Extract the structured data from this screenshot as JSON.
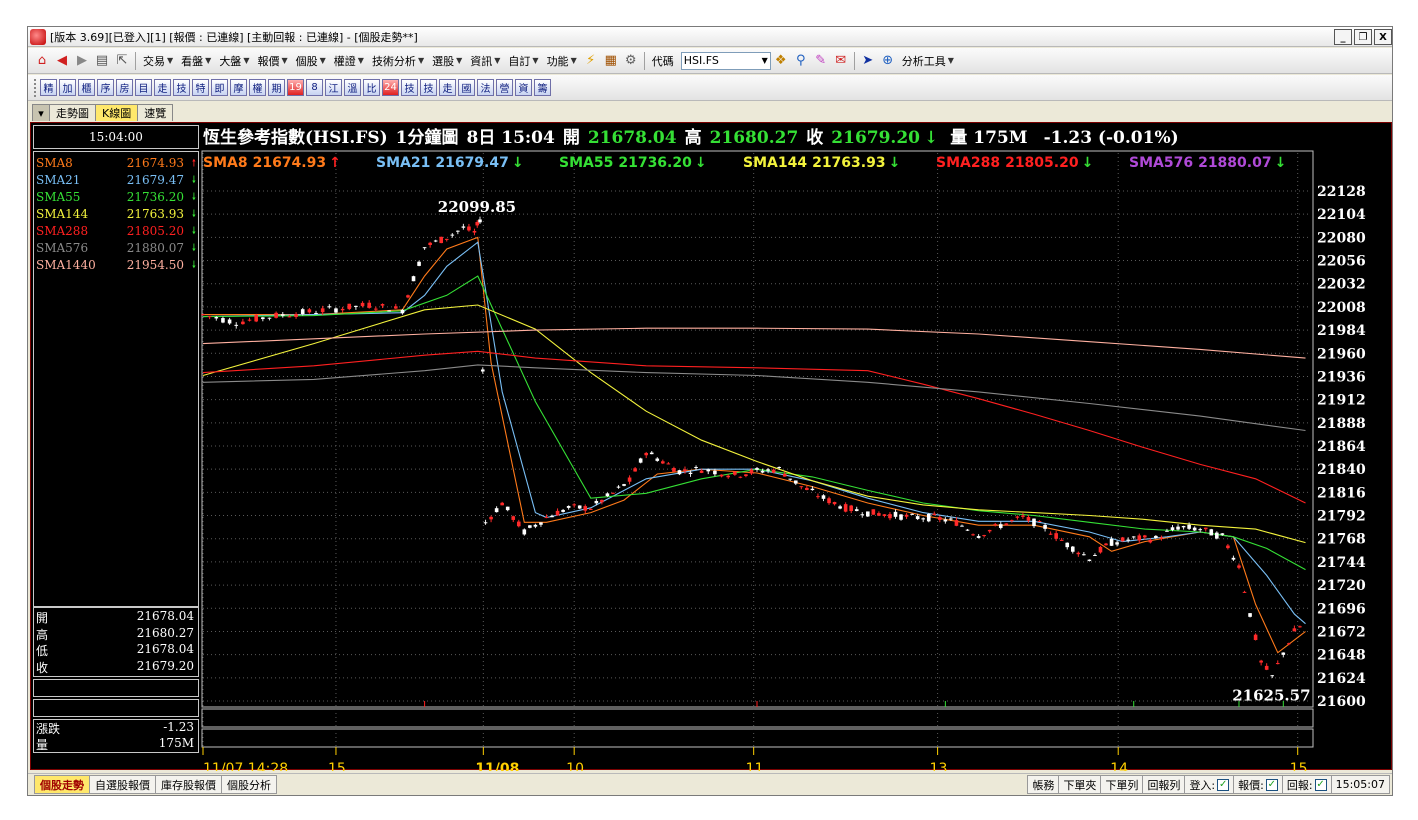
{
  "window": {
    "title": "[版本 3.69][已登入][1] [報價 : 已連線] [主動回報 : 已連線] - [個股走勢**]",
    "buttons": [
      "_",
      "❐",
      "X"
    ]
  },
  "menu": {
    "items": [
      "交易",
      "看盤",
      "大盤",
      "報價",
      "個股",
      "權證",
      "技術分析",
      "選股",
      "資訊",
      "自訂",
      "功能"
    ],
    "code_label": "代碼",
    "code_value": "HSI.FS",
    "analysis_label": "分析工具"
  },
  "toolbar2": {
    "buttons": [
      "精",
      "加",
      "櫃",
      "序",
      "房",
      "目",
      "走",
      "技",
      "特",
      "即",
      "摩",
      "權",
      "期",
      "19",
      "8",
      "江",
      "溫",
      "比",
      "24",
      "技",
      "技",
      "走",
      "國",
      "法",
      "營",
      "資",
      "籌"
    ]
  },
  "tabs": [
    "走勢圖",
    "K線圖",
    "速覽"
  ],
  "left_panel": {
    "time": "15:04:00",
    "sma_rows": [
      {
        "name": "SMA8",
        "value": "21674.93",
        "dir": "up",
        "color": "#ff7a1a"
      },
      {
        "name": "SMA21",
        "value": "21679.47",
        "dir": "down",
        "color": "#79bff5"
      },
      {
        "name": "SMA55",
        "value": "21736.20",
        "dir": "down",
        "color": "#35e035"
      },
      {
        "name": "SMA144",
        "value": "21763.93",
        "dir": "down",
        "color": "#f2f23c"
      },
      {
        "name": "SMA288",
        "value": "21805.20",
        "dir": "down",
        "color": "#ff2020"
      },
      {
        "name": "SMA576",
        "value": "21880.07",
        "dir": "down",
        "color": "#8a8a8a"
      },
      {
        "name": "SMA1440",
        "value": "21954.50",
        "dir": "down",
        "color": "#ffb0a0"
      }
    ],
    "ohlc": [
      {
        "label": "開",
        "value": "21678.04"
      },
      {
        "label": "高",
        "value": "21680.27"
      },
      {
        "label": "低",
        "value": "21678.04"
      },
      {
        "label": "收",
        "value": "21679.20"
      }
    ],
    "change_label": "漲跌",
    "change_value": "-1.23",
    "volume_label": "量",
    "volume_value": "175M"
  },
  "header": {
    "name": "恆生參考指數(HSI.FS)",
    "period": "1分鐘圖",
    "datetime": "8日 15:04",
    "open_label": "開",
    "open_value": "21678.04",
    "high_label": "高",
    "high_value": "21680.27",
    "close_label": "收",
    "close_value": "21679.20",
    "vol_label": "量",
    "vol_value": "175M",
    "change": "-1.23 (-0.01%)"
  },
  "legend": [
    {
      "name": "SMA8",
      "value": "21674.93",
      "dir": "up",
      "color": "#ff7a1a"
    },
    {
      "name": "SMA21",
      "value": "21679.47",
      "dir": "down",
      "color": "#79bff5"
    },
    {
      "name": "SMA55",
      "value": "21736.20",
      "dir": "down",
      "color": "#35e035"
    },
    {
      "name": "SMA144",
      "value": "21763.93",
      "dir": "down",
      "color": "#f2f23c"
    },
    {
      "name": "SMA288",
      "value": "21805.20",
      "dir": "down",
      "color": "#ff2020"
    },
    {
      "name": "SMA576",
      "value": "21880.07",
      "dir": "down",
      "color": "#b04ad8"
    }
  ],
  "chart_data": {
    "type": "line",
    "title": "恆生參考指數(HSI.FS) 1分鐘圖",
    "ylim": [
      21600,
      22128
    ],
    "y_ticks": [
      21600,
      21624,
      21648,
      21672,
      21696,
      21720,
      21744,
      21768,
      21792,
      21816,
      21840,
      21864,
      21888,
      21912,
      21936,
      21960,
      21984,
      22008,
      22032,
      22056,
      22080,
      22104,
      22128
    ],
    "x_ticks": [
      {
        "label": "11/07 14:28",
        "pos": 0.0
      },
      {
        "label": "15",
        "pos": 0.12
      },
      {
        "label": "11/08",
        "pos": 0.253
      },
      {
        "label": "10",
        "pos": 0.335
      },
      {
        "label": "11",
        "pos": 0.497
      },
      {
        "label": "13",
        "pos": 0.663
      },
      {
        "label": "14",
        "pos": 0.826
      },
      {
        "label": "15",
        "pos": 0.988
      }
    ],
    "annotations": [
      {
        "text": "22099.85",
        "x": 0.248,
        "y": 22099.85
      },
      {
        "text": "21625.57",
        "x": 0.965,
        "y": 21625.57
      }
    ],
    "price": {
      "x": [
        0,
        0.03,
        0.06,
        0.09,
        0.12,
        0.15,
        0.18,
        0.2,
        0.22,
        0.235,
        0.245,
        0.25,
        0.255,
        0.27,
        0.29,
        0.31,
        0.33,
        0.35,
        0.37,
        0.385,
        0.4,
        0.415,
        0.43,
        0.45,
        0.48,
        0.5,
        0.52,
        0.54,
        0.56,
        0.58,
        0.6,
        0.62,
        0.64,
        0.66,
        0.68,
        0.7,
        0.72,
        0.74,
        0.76,
        0.78,
        0.8,
        0.82,
        0.84,
        0.86,
        0.88,
        0.9,
        0.92,
        0.935,
        0.945,
        0.955,
        0.965,
        0.975,
        0.985,
        0.995
      ],
      "y": [
        22000,
        21992,
        21998,
        22002,
        22006,
        22010,
        22005,
        22070,
        22080,
        22090,
        22085,
        22099,
        21785,
        21805,
        21775,
        21790,
        21800,
        21800,
        21815,
        21828,
        21858,
        21848,
        21838,
        21840,
        21834,
        21838,
        21840,
        21822,
        21810,
        21800,
        21795,
        21793,
        21790,
        21790,
        21785,
        21772,
        21782,
        21790,
        21780,
        21762,
        21748,
        21764,
        21768,
        21768,
        21780,
        21778,
        21770,
        21740,
        21690,
        21640,
        21625,
        21650,
        21672,
        21682
      ]
    },
    "series": [
      {
        "name": "SMA8",
        "color": "#ff7a1a",
        "x": [
          0,
          0.1,
          0.18,
          0.2,
          0.22,
          0.248,
          0.26,
          0.29,
          0.31,
          0.35,
          0.38,
          0.41,
          0.45,
          0.5,
          0.55,
          0.6,
          0.65,
          0.7,
          0.75,
          0.8,
          0.82,
          0.85,
          0.9,
          0.93,
          0.95,
          0.97,
          0.995
        ],
        "y": [
          22000,
          22000,
          22005,
          22040,
          22068,
          22080,
          21950,
          21785,
          21785,
          21795,
          21808,
          21835,
          21840,
          21836,
          21822,
          21805,
          21792,
          21782,
          21782,
          21770,
          21755,
          21765,
          21775,
          21770,
          21700,
          21650,
          21672
        ]
      },
      {
        "name": "SMA21",
        "color": "#79bff5",
        "x": [
          0,
          0.1,
          0.18,
          0.2,
          0.22,
          0.248,
          0.27,
          0.3,
          0.31,
          0.35,
          0.4,
          0.45,
          0.5,
          0.55,
          0.6,
          0.65,
          0.7,
          0.75,
          0.8,
          0.83,
          0.87,
          0.9,
          0.93,
          0.96,
          0.985,
          0.995
        ],
        "y": [
          21998,
          22000,
          22002,
          22020,
          22050,
          22075,
          21920,
          21795,
          21790,
          21800,
          21830,
          21840,
          21840,
          21828,
          21810,
          21795,
          21786,
          21786,
          21775,
          21765,
          21770,
          21775,
          21770,
          21730,
          21690,
          21680
        ]
      },
      {
        "name": "SMA55",
        "color": "#35e035",
        "x": [
          0,
          0.1,
          0.18,
          0.22,
          0.248,
          0.3,
          0.35,
          0.4,
          0.45,
          0.5,
          0.55,
          0.6,
          0.65,
          0.7,
          0.75,
          0.8,
          0.85,
          0.9,
          0.93,
          0.96,
          0.995
        ],
        "y": [
          21998,
          21999,
          22004,
          22020,
          22040,
          21910,
          21810,
          21815,
          21830,
          21840,
          21832,
          21818,
          21805,
          21797,
          21792,
          21785,
          21778,
          21775,
          21770,
          21758,
          21736
        ]
      },
      {
        "name": "SMA144",
        "color": "#f2f23c",
        "x": [
          0,
          0.1,
          0.2,
          0.248,
          0.3,
          0.35,
          0.4,
          0.45,
          0.5,
          0.55,
          0.6,
          0.65,
          0.7,
          0.75,
          0.8,
          0.85,
          0.9,
          0.95,
          0.995
        ],
        "y": [
          21937,
          21970,
          22005,
          22010,
          21985,
          21940,
          21900,
          21870,
          21848,
          21828,
          21812,
          21803,
          21798,
          21795,
          21792,
          21788,
          21782,
          21778,
          21764
        ]
      },
      {
        "name": "SMA288",
        "color": "#ff2020",
        "x": [
          0,
          0.1,
          0.2,
          0.248,
          0.3,
          0.4,
          0.5,
          0.6,
          0.65,
          0.7,
          0.75,
          0.8,
          0.85,
          0.9,
          0.95,
          0.995
        ],
        "y": [
          21940,
          21947,
          21958,
          21962,
          21955,
          21947,
          21945,
          21942,
          21928,
          21913,
          21897,
          21880,
          21862,
          21845,
          21830,
          21805
        ]
      },
      {
        "name": "SMA576",
        "color": "#8a8a8a",
        "x": [
          0,
          0.1,
          0.2,
          0.248,
          0.3,
          0.4,
          0.5,
          0.6,
          0.7,
          0.8,
          0.9,
          0.995
        ],
        "y": [
          21930,
          21933,
          21942,
          21948,
          21945,
          21940,
          21937,
          21930,
          21920,
          21908,
          21895,
          21880
        ]
      },
      {
        "name": "SMA1440",
        "color": "#ffb0a0",
        "x": [
          0,
          0.1,
          0.2,
          0.3,
          0.4,
          0.5,
          0.6,
          0.7,
          0.8,
          0.9,
          0.995
        ],
        "y": [
          21970,
          21975,
          21980,
          21984,
          21986,
          21986,
          21985,
          21980,
          21972,
          21964,
          21955
        ]
      }
    ]
  },
  "statusbar": {
    "tabs": [
      "個股走勢",
      "自選股報價",
      "庫存股報價",
      "個股分析"
    ],
    "right": [
      "帳務",
      "下單夾",
      "下單列",
      "回報列"
    ],
    "login_label": "登入:",
    "quote_label": "報價:",
    "report_label": "回報:",
    "time": "15:05:07"
  }
}
